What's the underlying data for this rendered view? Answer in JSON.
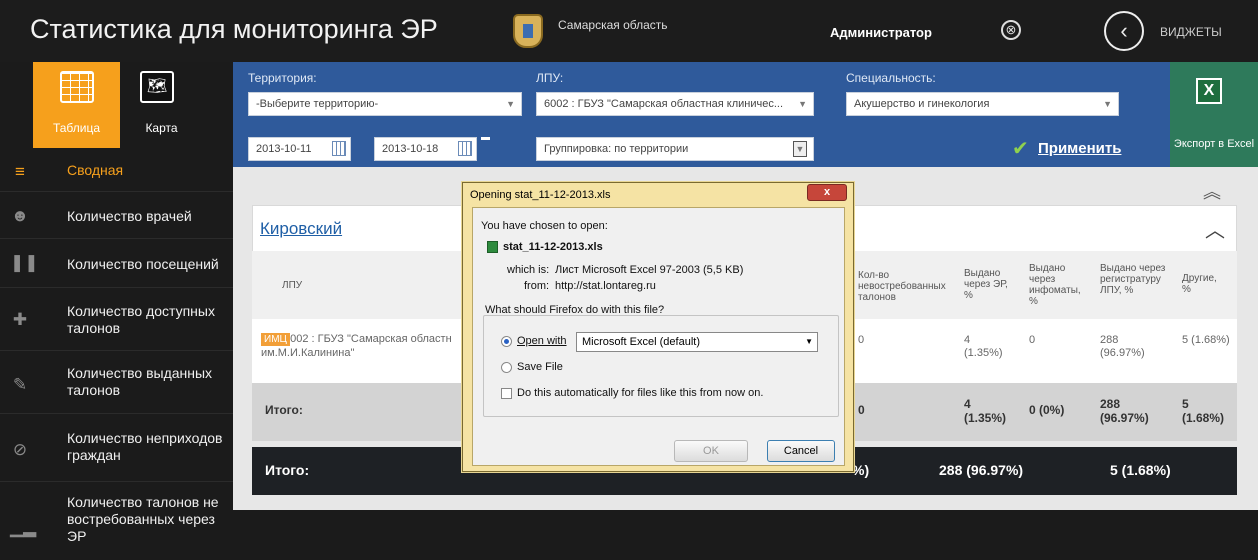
{
  "header": {
    "title": "Статистика для мониторинга ЭР",
    "region": "Самарская область",
    "user": "Администратор",
    "logout_icon": "⊗",
    "back_icon": "‹",
    "widgets": "ВИДЖЕТЫ"
  },
  "view_tabs": {
    "table": "Таблица",
    "map": "Карта",
    "map_icon": "🗺"
  },
  "sidebar": {
    "items": [
      {
        "label": "Сводная",
        "icon": "≡",
        "active": true
      },
      {
        "label": "Количество врачей",
        "icon": "☻"
      },
      {
        "label": "Количество посещений",
        "icon": "❚❚"
      },
      {
        "label": "Количество доступных талонов",
        "icon": "✚"
      },
      {
        "label": "Количество выданных талонов",
        "icon": "✎"
      },
      {
        "label": "Количество неприходов граждан",
        "icon": "⊘"
      },
      {
        "label": "Количество талонов не востребованных через ЭР",
        "icon": "▁▂"
      }
    ]
  },
  "filters": {
    "territory_label": "Территория:",
    "territory_value": "-Выберите территорию-",
    "lpu_label": "ЛПУ:",
    "lpu_value": "6002 : ГБУЗ \"Самарская областная клиничес...",
    "spec_label": "Специальность:",
    "spec_value": "Акушерство и гинекология",
    "date_from": "2013-10-11",
    "date_to": "2013-10-18",
    "grouping": "Группировка: по территории",
    "apply": "Применить",
    "check_icon": "✔"
  },
  "export": {
    "label": "Экспорт в Excel",
    "icon": "X"
  },
  "card": {
    "title": "Кировский",
    "collapse_all_icon": "︽",
    "collapse_icon": "︿",
    "columns": {
      "lpu": "ЛПУ",
      "unclaimed": "Кол-во невостребованных талонов",
      "via_er": "Выдано через ЭР, %",
      "via_info": "Выдано через инфоматы, %",
      "via_reg": "Выдано через регистратуру ЛПУ, %",
      "other": "Другие, %"
    },
    "row": {
      "badge": "ИМЦ",
      "lpu_line1": "6002 : ГБУЗ \"Самарская областн",
      "lpu_line2": "им.М.И.Калинина\"",
      "unclaimed": "0",
      "via_er": "4 (1.35%)",
      "via_info": "0",
      "via_reg": "288 (96.97%)",
      "other": "5 (1.68%)"
    },
    "subtotal": {
      "label": "Итого:",
      "unclaimed": "0",
      "via_er": "4 (1.35%)",
      "via_info": "0 (0%)",
      "via_reg": "288 (96.97%)",
      "other": "5 (1.68%)"
    }
  },
  "grand_total": {
    "label": "Итого:",
    "col_a": "%)",
    "col_b": "288 (96.97%)",
    "col_c": "5 (1.68%)"
  },
  "dialog": {
    "title": "Opening stat_11-12-2013.xls",
    "close_icon": "x",
    "intro": "You have chosen to open:",
    "filename": "stat_11-12-2013.xls",
    "which_label": "which is:",
    "which_value": "Лист Microsoft Excel 97-2003 (5,5 KB)",
    "from_label": "from:",
    "from_value": "http://stat.lontareg.ru",
    "question": "What should Firefox do with this file?",
    "open_with": "Open with",
    "app": "Microsoft Excel (default)",
    "save_file": "Save File",
    "auto": "Do this automatically for files like this from now on.",
    "ok": "OK",
    "cancel": "Cancel"
  }
}
